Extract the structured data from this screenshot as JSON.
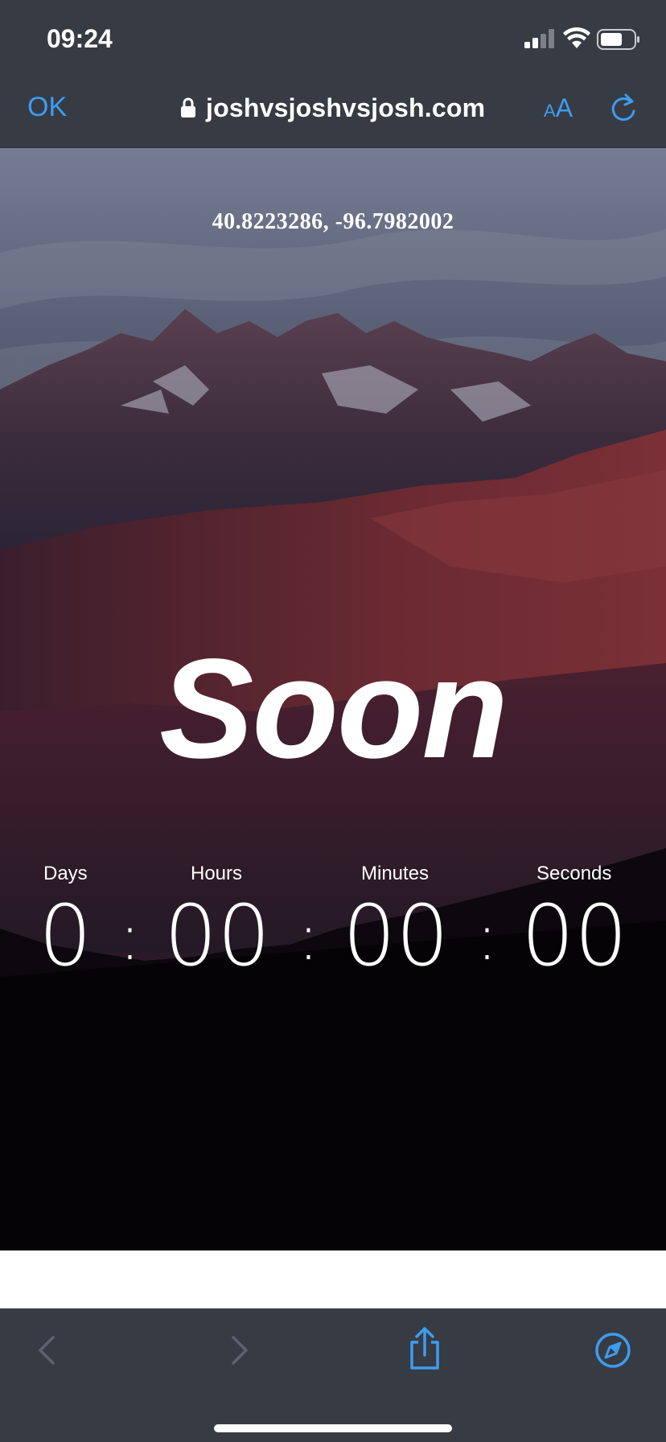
{
  "status_bar": {
    "time": "09:24"
  },
  "browser": {
    "done_label": "OK",
    "url": "joshvsjoshvsjosh.com",
    "text_size_small": "A",
    "text_size_large": "A"
  },
  "page": {
    "coordinates": "40.8223286, -96.7982002",
    "headline": "Soon",
    "countdown": {
      "labels": {
        "days": "Days",
        "hours": "Hours",
        "minutes": "Minutes",
        "seconds": "Seconds"
      },
      "values": {
        "days": "0",
        "hours": "00",
        "minutes": "00",
        "seconds": "00"
      },
      "separator": ":"
    }
  },
  "colors": {
    "accent": "#3f9cf0",
    "chrome": "#373b44",
    "text": "#ffffff"
  },
  "icons": {
    "lock": "lock-icon",
    "reload": "reload-icon",
    "back": "chevron-left-icon",
    "forward": "chevron-right-icon",
    "share": "share-icon",
    "compass": "compass-icon"
  }
}
